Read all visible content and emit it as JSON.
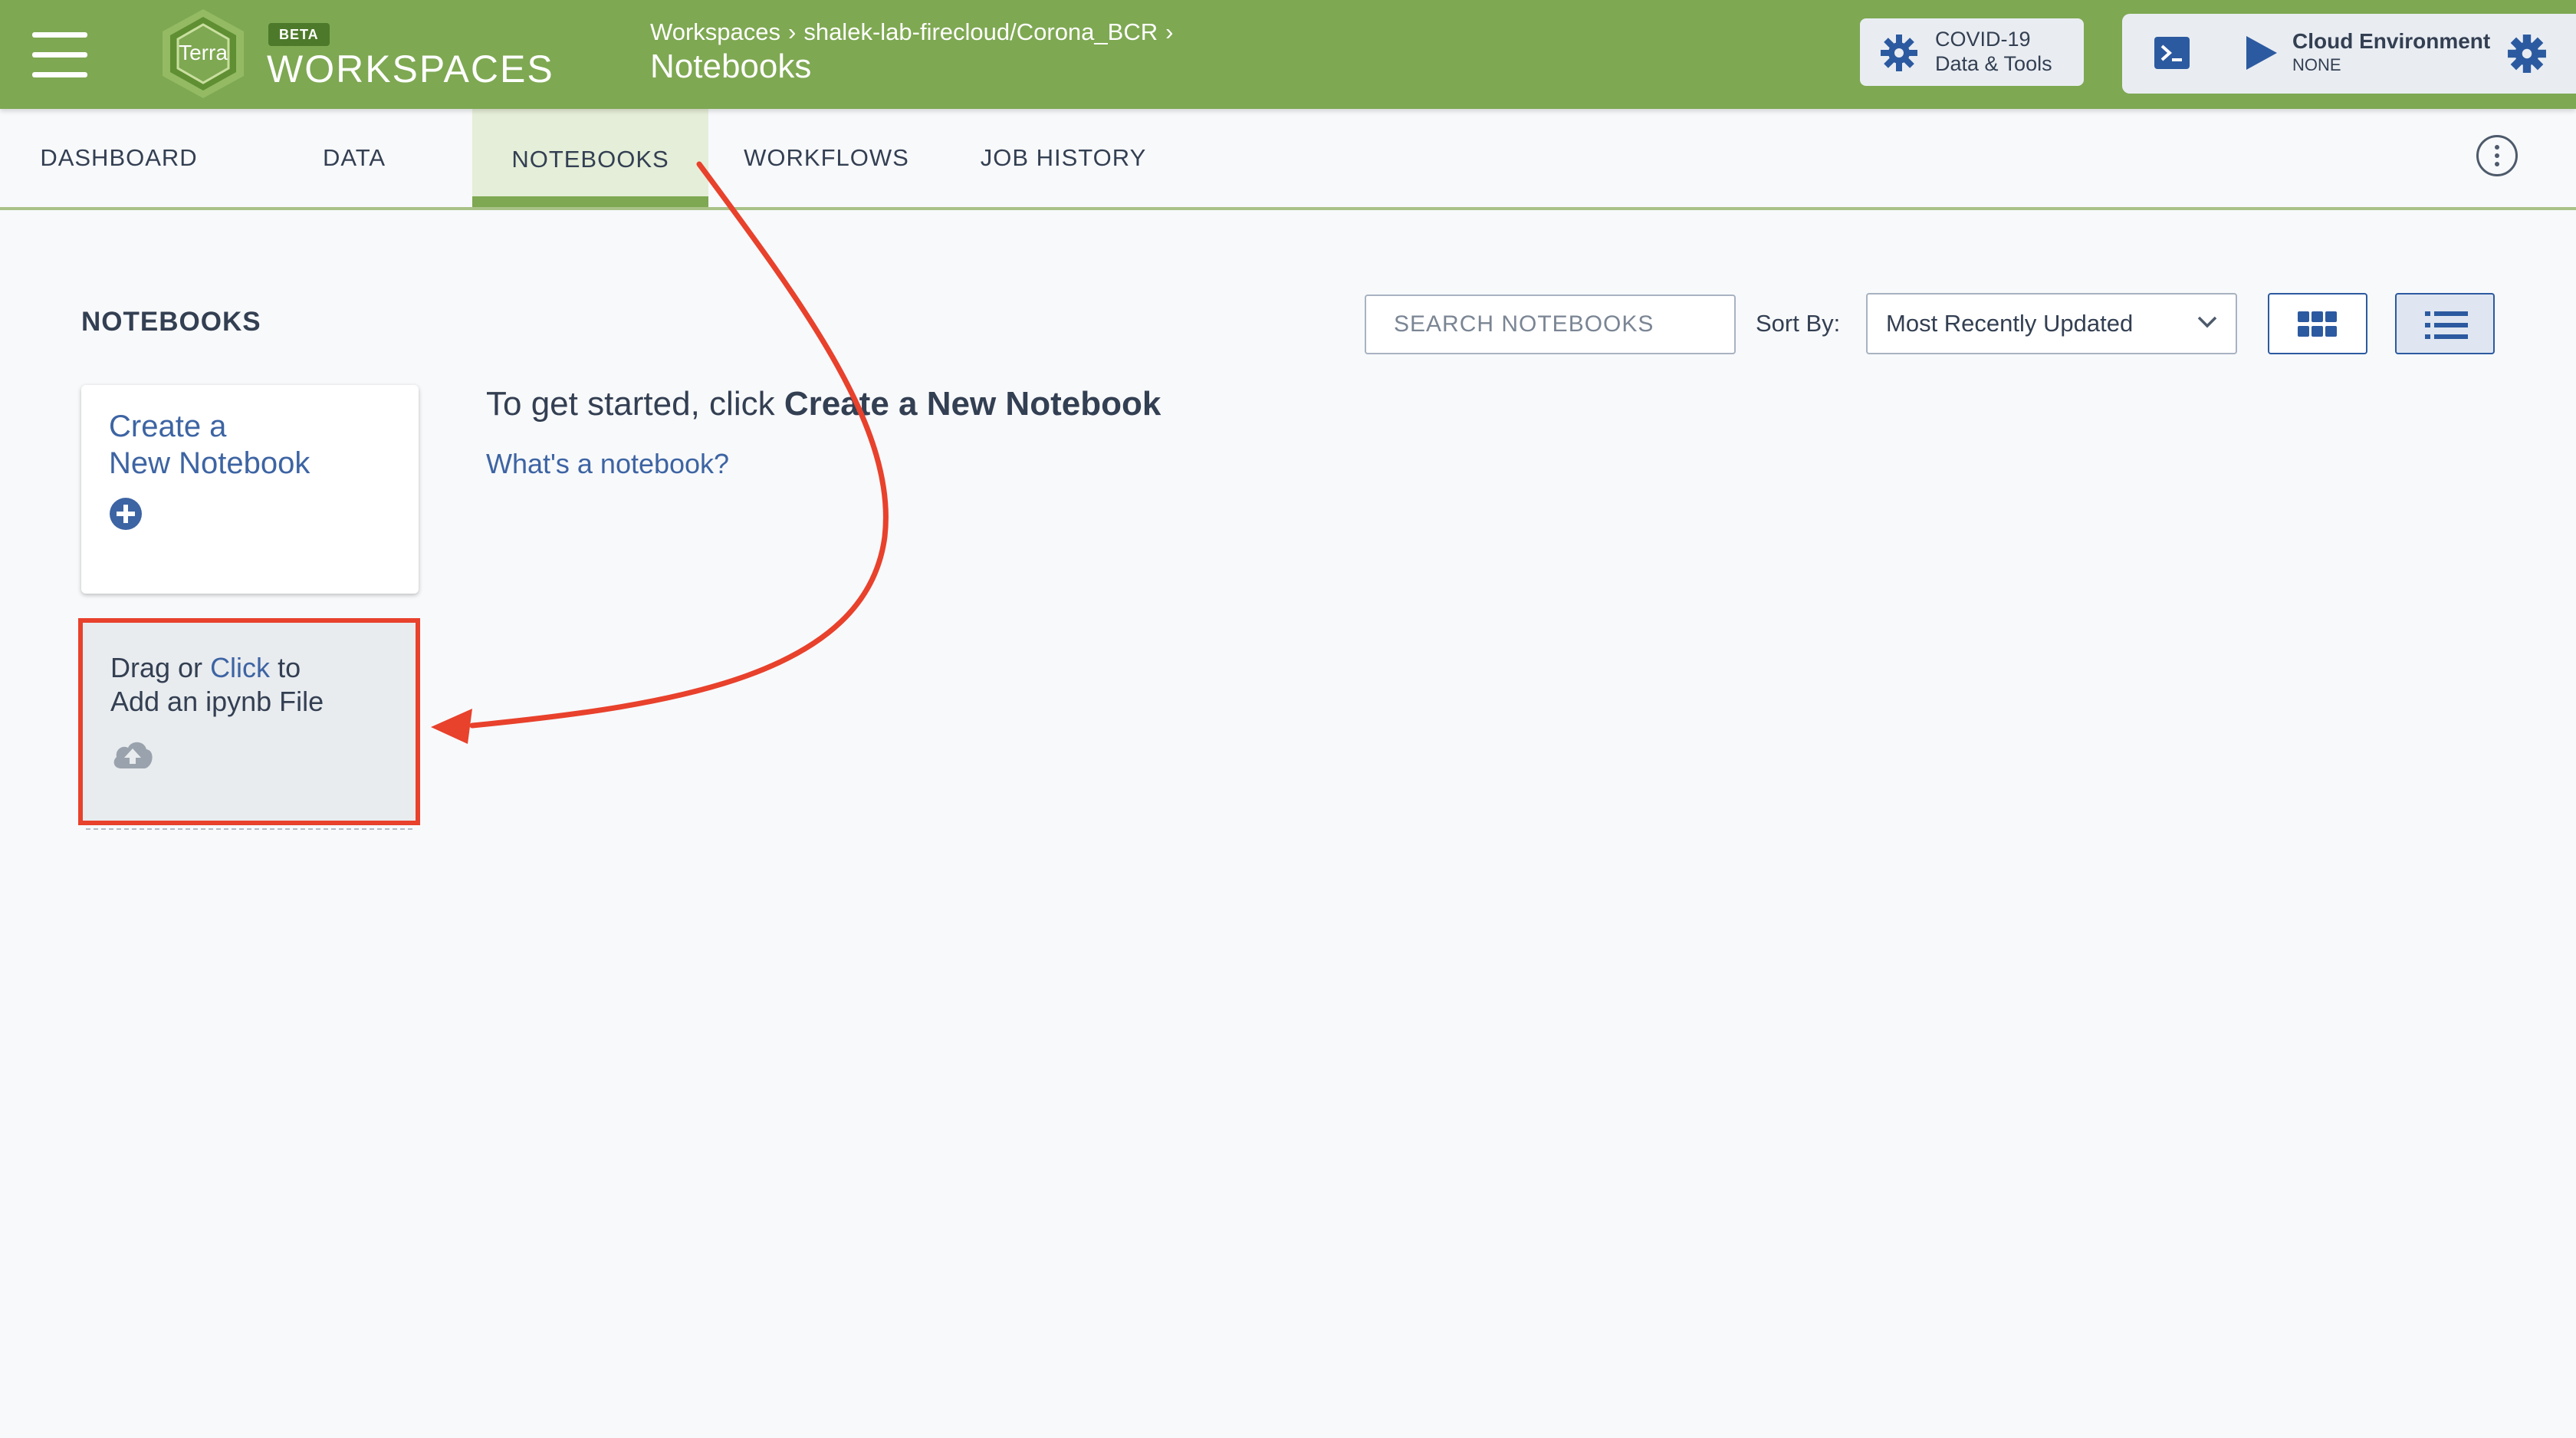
{
  "header": {
    "logo_text": "Terra",
    "beta_label": "BETA",
    "product_name": "WORKSPACES",
    "breadcrumb": {
      "root": "Workspaces",
      "workspace": "shalek-lab-firecloud/Corona_BCR",
      "separator": "›"
    },
    "page_title": "Notebooks",
    "covid_button": {
      "line1": "COVID-19",
      "line2": "Data & Tools"
    },
    "cloud_environment": {
      "title": "Cloud Environment",
      "status": "NONE"
    }
  },
  "tabs": [
    {
      "label": "DASHBOARD",
      "active": false
    },
    {
      "label": "DATA",
      "active": false
    },
    {
      "label": "NOTEBOOKS",
      "active": true
    },
    {
      "label": "WORKFLOWS",
      "active": false
    },
    {
      "label": "JOB HISTORY",
      "active": false
    }
  ],
  "main": {
    "section_title": "NOTEBOOKS",
    "search": {
      "placeholder": "SEARCH NOTEBOOKS",
      "value": ""
    },
    "sort": {
      "label": "Sort By:",
      "selected": "Most Recently Updated"
    },
    "create_card": {
      "line1": "Create a",
      "line2": "New Notebook"
    },
    "upload_card": {
      "prefix": "Drag or",
      "link": "Click",
      "suffix": "to",
      "line2": "Add an ipynb File"
    },
    "get_started": {
      "prefix": "To get started, click",
      "bold": "Create a New Notebook"
    },
    "whats_link": "What's a notebook?"
  },
  "colors": {
    "header_green": "#7ea852",
    "link_blue": "#3d64a3",
    "annotation_red": "#e8412c"
  },
  "icons": {
    "menu": "hamburger-icon",
    "covid": "gear-icon",
    "terminal": "terminal-icon",
    "play": "play-icon",
    "settings": "gear-icon",
    "more": "kebab-icon",
    "grid_view": "grid-view-icon",
    "list_view": "list-view-icon",
    "add": "plus-circle-icon",
    "upload": "cloud-upload-icon"
  }
}
